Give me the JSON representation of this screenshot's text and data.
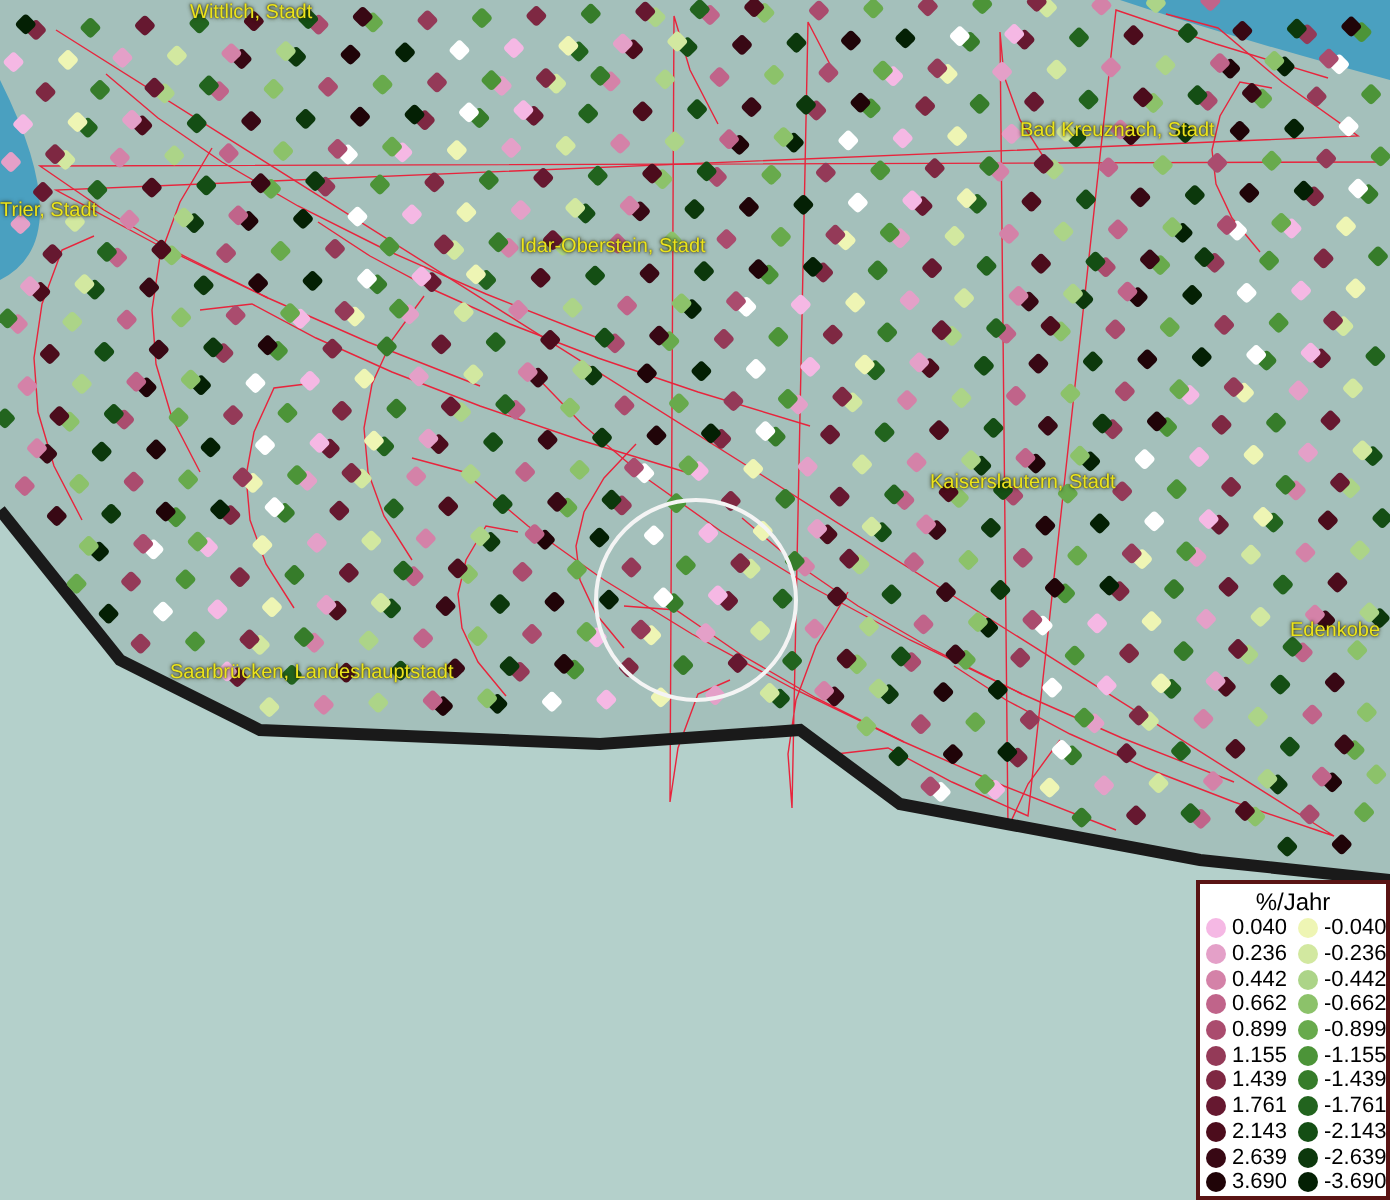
{
  "map": {
    "labels": [
      {
        "text": "Wittlich, Stadt"
      },
      {
        "text": "Trier, Stadt"
      },
      {
        "text": "Idar-Oberstein, Stadt"
      },
      {
        "text": "Bad Kreuznach, Stadt"
      },
      {
        "text": "Kaiserslautern, Stadt"
      },
      {
        "text": "Saarbrücken, Landeshauptstadt"
      },
      {
        "text": "Edenkobe"
      }
    ]
  },
  "legend": {
    "title": "%/Jahr",
    "entries": [
      {
        "value": "0.040",
        "color": "#f5b8e4"
      },
      {
        "value": "-0.040",
        "color": "#eef5b4"
      },
      {
        "value": "0.236",
        "color": "#e4a0c8"
      },
      {
        "value": "-0.236",
        "color": "#d2e8a0"
      },
      {
        "value": "0.442",
        "color": "#d482a8"
      },
      {
        "value": "-0.442",
        "color": "#acd488"
      },
      {
        "value": "0.662",
        "color": "#c0648a"
      },
      {
        "value": "-0.662",
        "color": "#8cc26a"
      },
      {
        "value": "0.899",
        "color": "#aa4c6e"
      },
      {
        "value": "-0.899",
        "color": "#68aa4c"
      },
      {
        "value": "1.155",
        "color": "#943a58"
      },
      {
        "value": "-1.155",
        "color": "#4c9438"
      },
      {
        "value": "1.439",
        "color": "#7e2842"
      },
      {
        "value": "-1.439",
        "color": "#367c2a"
      },
      {
        "value": "1.761",
        "color": "#661830"
      },
      {
        "value": "-1.761",
        "color": "#22641e"
      },
      {
        "value": "2.143",
        "color": "#4c0c1c"
      },
      {
        "value": "-2.143",
        "color": "#144e14"
      },
      {
        "value": "2.639",
        "color": "#380814"
      },
      {
        "value": "-2.639",
        "color": "#0c380c"
      },
      {
        "value": "3.690",
        "color": "#200408"
      },
      {
        "value": "-3.690",
        "color": "#042004"
      }
    ]
  }
}
